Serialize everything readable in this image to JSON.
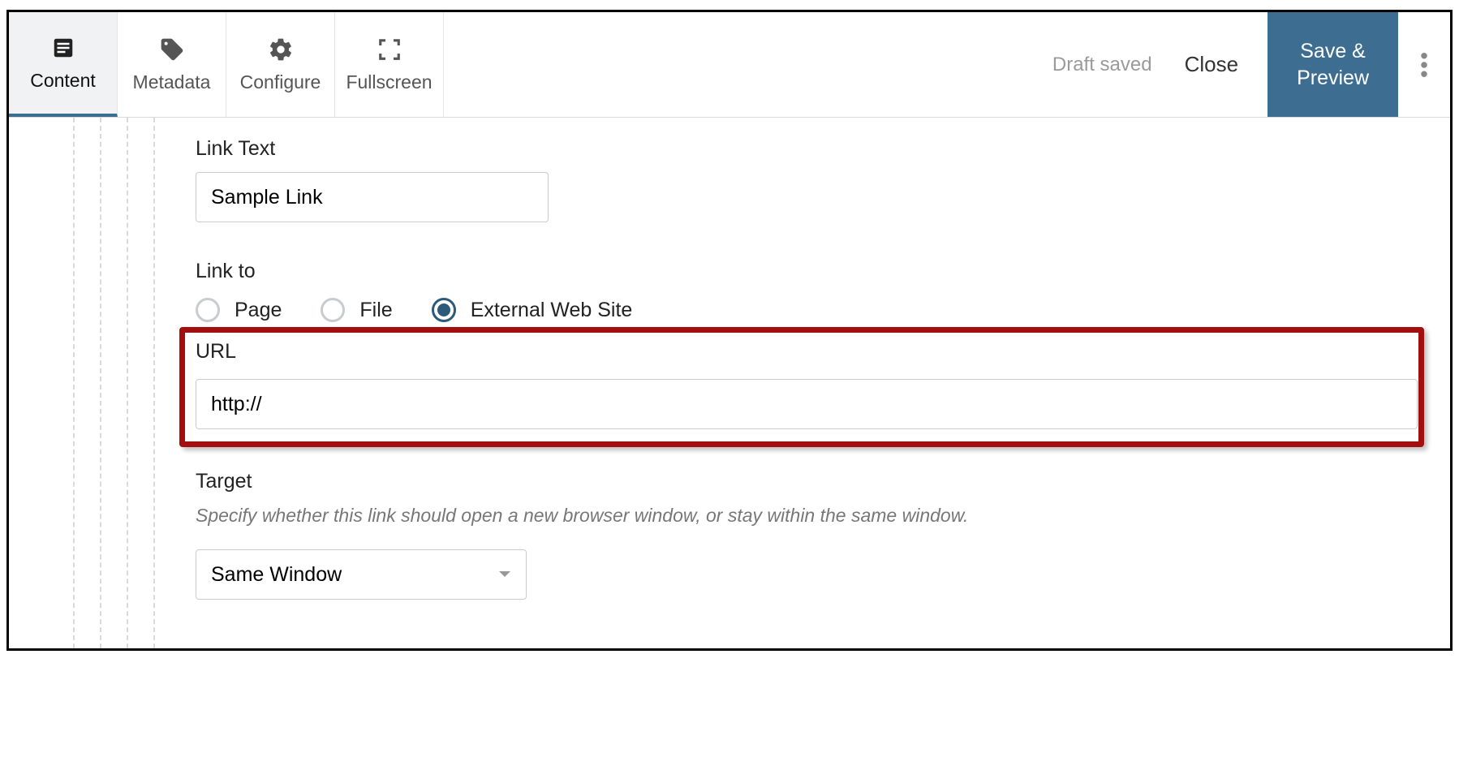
{
  "toolbar": {
    "tabs": [
      {
        "label": "Content"
      },
      {
        "label": "Metadata"
      },
      {
        "label": "Configure"
      },
      {
        "label": "Fullscreen"
      }
    ],
    "status": "Draft saved",
    "close": "Close",
    "save": "Save & Preview"
  },
  "form": {
    "link_text_label": "Link Text",
    "link_text_value": "Sample Link",
    "link_to_label": "Link to",
    "link_to_options": {
      "page": "Page",
      "file": "File",
      "external": "External Web Site"
    },
    "url_label": "URL",
    "url_value": "http://",
    "target_label": "Target",
    "target_help": "Specify whether this link should open a new browser window, or stay within the same window.",
    "target_value": "Same Window"
  }
}
